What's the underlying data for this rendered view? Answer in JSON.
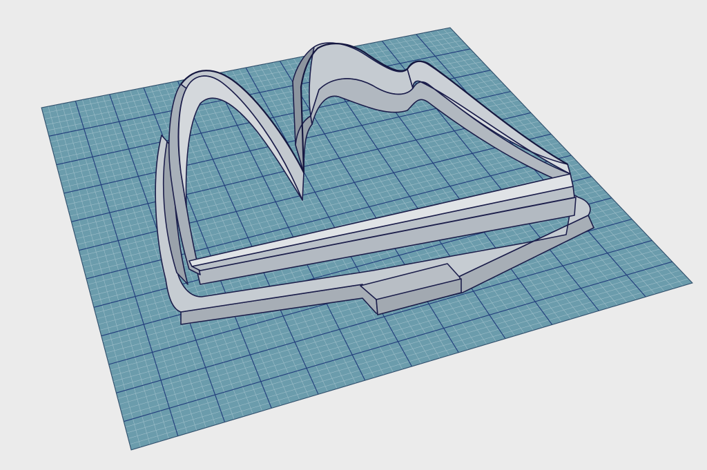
{
  "viewport": {
    "background_color": "#ebebeb",
    "render_mode": "shaded-3d",
    "content": "cookie-cutter-model",
    "shape": "arches-letter-m"
  },
  "build_plate": {
    "color": "#6b9cac",
    "minor_grid_color": "#a9c5cf",
    "major_grid_color": "#1f3a7a",
    "grid_visible": true
  },
  "model": {
    "face_color": "#b7bec6",
    "top_color": "#d7dbdf",
    "shadow_color": "#8d959f",
    "edge_color": "#1b1d4a"
  }
}
